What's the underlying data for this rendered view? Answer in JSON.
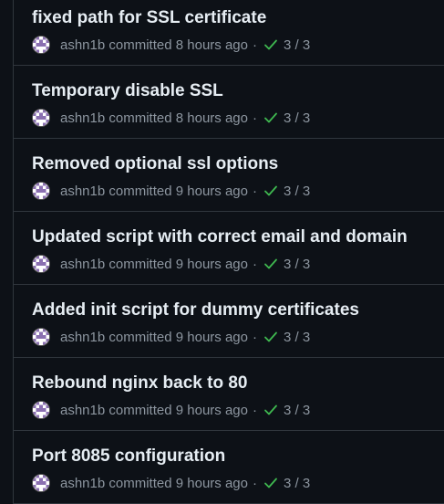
{
  "commits": [
    {
      "title": "fixed path for SSL certificate",
      "author": "ashn1b",
      "action": "committed",
      "time": "8 hours ago",
      "separator": "·",
      "checks": "3 / 3"
    },
    {
      "title": "Temporary disable SSL",
      "author": "ashn1b",
      "action": "committed",
      "time": "8 hours ago",
      "separator": "·",
      "checks": "3 / 3"
    },
    {
      "title": "Removed optional ssl options",
      "author": "ashn1b",
      "action": "committed",
      "time": "9 hours ago",
      "separator": "·",
      "checks": "3 / 3"
    },
    {
      "title": "Updated script with correct email and domain",
      "author": "ashn1b",
      "action": "committed",
      "time": "9 hours ago",
      "separator": "·",
      "checks": "3 / 3"
    },
    {
      "title": "Added init script for dummy certificates",
      "author": "ashn1b",
      "action": "committed",
      "time": "9 hours ago",
      "separator": "·",
      "checks": "3 / 3"
    },
    {
      "title": "Rebound nginx back to 80",
      "author": "ashn1b",
      "action": "committed",
      "time": "9 hours ago",
      "separator": "·",
      "checks": "3 / 3"
    },
    {
      "title": "Port 8085 configuration",
      "author": "ashn1b",
      "action": "committed",
      "time": "9 hours ago",
      "separator": "·",
      "checks": "3 / 3"
    }
  ],
  "colors": {
    "background": "#0d1117",
    "title": "#e6edf3",
    "meta": "#8d96a0",
    "success": "#3fb950",
    "border": "#30363d"
  },
  "icons": {
    "avatar": "identicon-avatar",
    "status": "check-icon"
  }
}
